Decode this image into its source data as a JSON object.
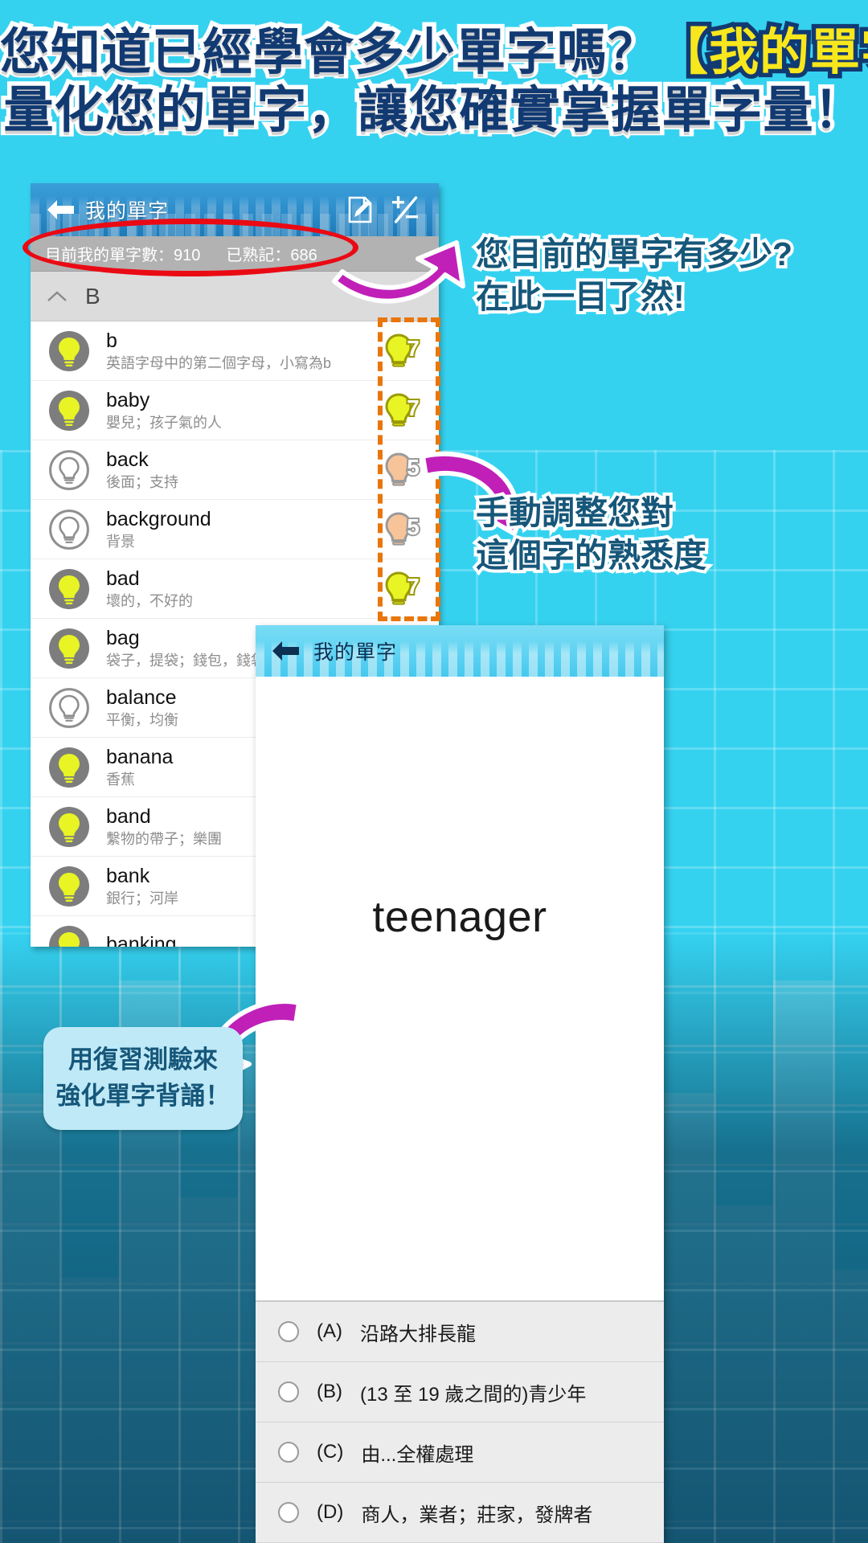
{
  "headline": {
    "line1_prefix": "您知道已經學會多少單字嗎？",
    "line1_highlight": "【我的單字】",
    "line2": "量化您的單字，讓您確實掌握單字量！"
  },
  "word_list_screen": {
    "appbar": {
      "back_label": "←",
      "title": "我的單字",
      "action_edit": "edit-note-icon",
      "action_adjust": "plus-minus-icon"
    },
    "stats": {
      "total_label": "目前我的單字數：910",
      "mastered_label": "已熟記：686",
      "total_count": 910,
      "mastered_count": 686
    },
    "section": {
      "letter": "B",
      "collapse_icon": "chevron-up-icon"
    },
    "items": [
      {
        "word": "b",
        "definition": "英語字母中的第二個字母，小寫為b",
        "learned": true,
        "level": 7
      },
      {
        "word": "baby",
        "definition": "嬰兒；孩子氣的人",
        "learned": true,
        "level": 7
      },
      {
        "word": "back",
        "definition": "後面；支持",
        "learned": false,
        "level": 5
      },
      {
        "word": "background",
        "definition": "背景",
        "learned": false,
        "level": 5
      },
      {
        "word": "bad",
        "definition": "壞的，不好的",
        "learned": true,
        "level": 7
      },
      {
        "word": "bag",
        "definition": "袋子，提袋；錢包，錢袋",
        "learned": true,
        "level": null
      },
      {
        "word": "balance",
        "definition": "平衡，均衡",
        "learned": false,
        "level": null
      },
      {
        "word": "banana",
        "definition": "香蕉",
        "learned": true,
        "level": null
      },
      {
        "word": "band",
        "definition": "繫物的帶子；樂團",
        "learned": true,
        "level": null
      },
      {
        "word": "bank",
        "definition": "銀行；河岸",
        "learned": true,
        "level": null
      },
      {
        "word": "banking",
        "definition": "",
        "learned": true,
        "level": null
      }
    ]
  },
  "quiz_screen": {
    "appbar": {
      "back_label": "←",
      "title": "我的單字"
    },
    "question_word": "teenager",
    "options": [
      {
        "key": "(A)",
        "text": "沿路大排長龍"
      },
      {
        "key": "(B)",
        "text": "(13 至 19 歲之間的)青少年"
      },
      {
        "key": "(C)",
        "text": "由...全權處理"
      },
      {
        "key": "(D)",
        "text": "商人，業者；莊家，發牌者"
      }
    ]
  },
  "annotations": {
    "callout_stats": {
      "line1": "您目前的單字有多少?",
      "line2": "在此一目了然!"
    },
    "callout_level": {
      "line1": "手動調整您對",
      "line2": "這個字的熟悉度"
    },
    "callout_quiz": {
      "line1": "用復習測驗來",
      "line2": "強化單字背誦！"
    }
  },
  "colors": {
    "background": "#35d2f0",
    "headline_navy": "#123a72",
    "headline_yellow": "#f8e71c",
    "callout_teal": "#16577a",
    "bubble_bg": "#bfe9f7",
    "arrow_magenta": "#c020b8",
    "highlight_red": "#ea0a14",
    "dashed_orange": "#e8760d",
    "bulb_yellow": "#e8f424",
    "bulb_gray": "#7d7d7d",
    "appbar_blue": "#2f8fcd"
  }
}
